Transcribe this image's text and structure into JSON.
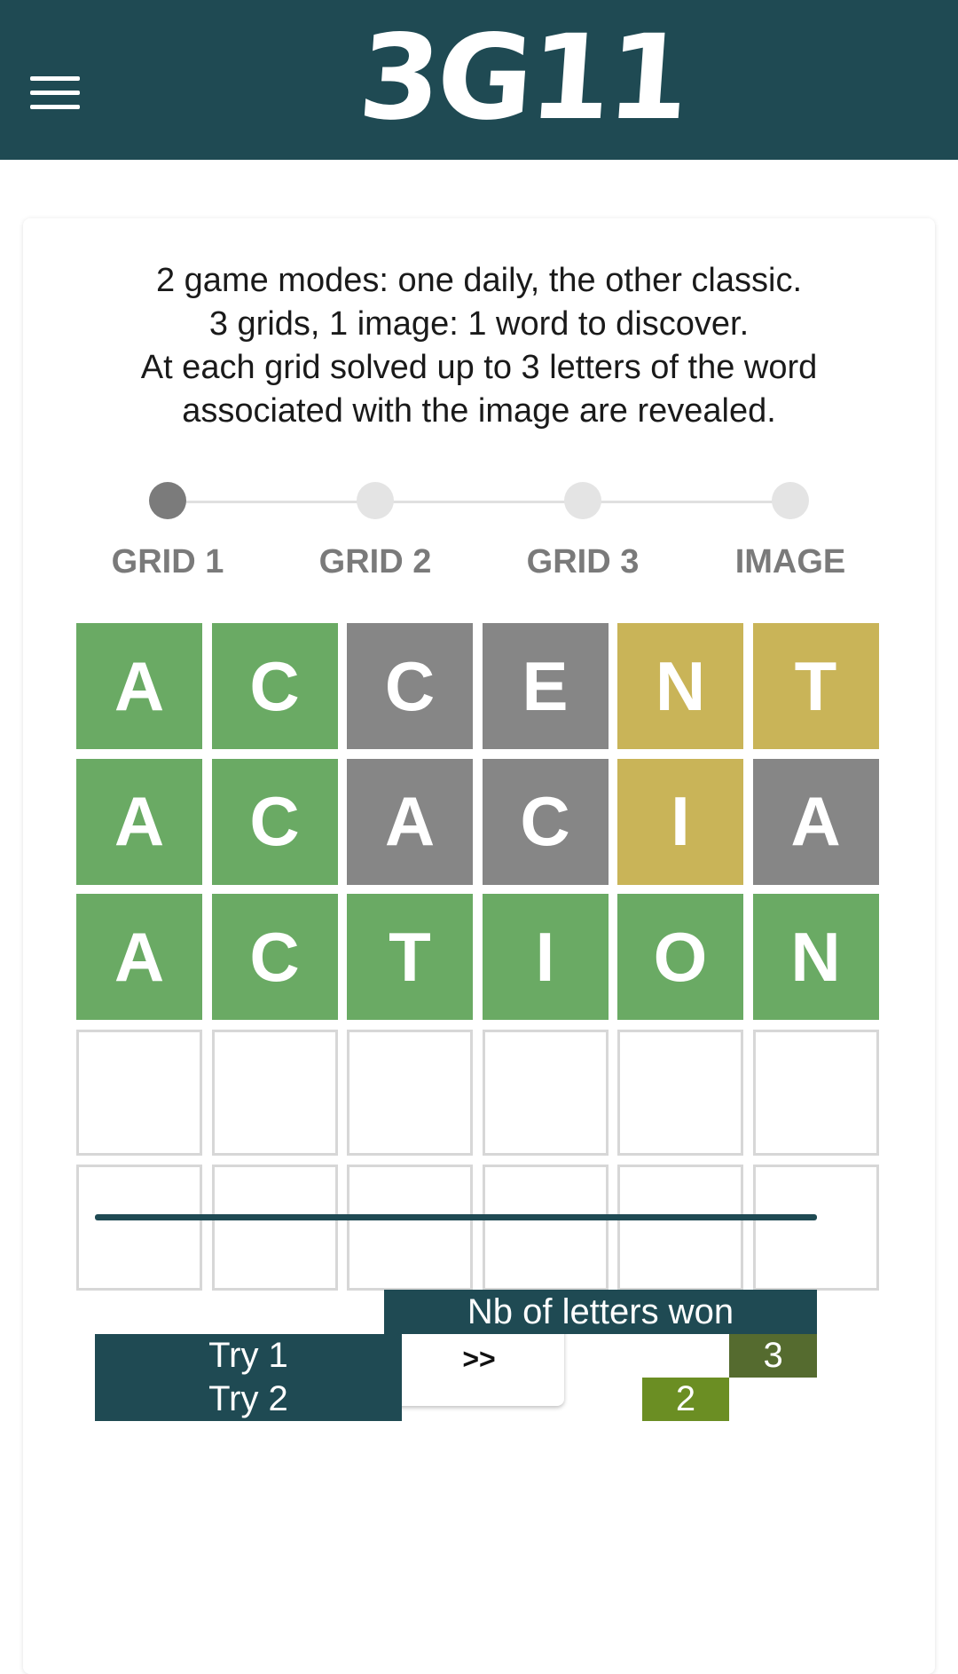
{
  "header": {
    "logo": "3G11",
    "menu_icon": "hamburger-menu-icon",
    "background": "#1f4a53"
  },
  "intro": {
    "lines": [
      "2 game modes: one daily, the other classic.",
      "3 grids, 1 image: 1 word to discover.",
      "At each grid solved up to 3 letters of the word",
      "associated with the image are revealed."
    ]
  },
  "stepper": {
    "active_index": 0,
    "steps": [
      {
        "label": "GRID 1"
      },
      {
        "label": "GRID 2"
      },
      {
        "label": "GRID 3"
      },
      {
        "label": "IMAGE"
      }
    ]
  },
  "grid": {
    "colors": {
      "green": "#6aaa64",
      "gray": "#868686",
      "yellow": "#c9b458"
    },
    "rows": [
      [
        {
          "letter": "A",
          "state": "green"
        },
        {
          "letter": "C",
          "state": "green"
        },
        {
          "letter": "C",
          "state": "gray"
        },
        {
          "letter": "E",
          "state": "gray"
        },
        {
          "letter": "N",
          "state": "yellow"
        },
        {
          "letter": "T",
          "state": "yellow"
        }
      ],
      [
        {
          "letter": "A",
          "state": "green"
        },
        {
          "letter": "C",
          "state": "green"
        },
        {
          "letter": "A",
          "state": "gray"
        },
        {
          "letter": "C",
          "state": "gray"
        },
        {
          "letter": "I",
          "state": "yellow"
        },
        {
          "letter": "A",
          "state": "gray"
        }
      ],
      [
        {
          "letter": "A",
          "state": "green"
        },
        {
          "letter": "C",
          "state": "green"
        },
        {
          "letter": "T",
          "state": "green"
        },
        {
          "letter": "I",
          "state": "green"
        },
        {
          "letter": "O",
          "state": "green"
        },
        {
          "letter": "N",
          "state": "green"
        }
      ],
      [
        {
          "letter": "",
          "state": "empty"
        },
        {
          "letter": "",
          "state": "empty"
        },
        {
          "letter": "",
          "state": "empty"
        },
        {
          "letter": "",
          "state": "empty"
        },
        {
          "letter": "",
          "state": "empty"
        },
        {
          "letter": "",
          "state": "empty"
        }
      ],
      [
        {
          "letter": "",
          "state": "empty"
        },
        {
          "letter": "",
          "state": "empty"
        },
        {
          "letter": "",
          "state": "empty"
        },
        {
          "letter": "",
          "state": "empty"
        },
        {
          "letter": "",
          "state": "empty"
        },
        {
          "letter": "",
          "state": "empty"
        }
      ]
    ]
  },
  "next_button": {
    "label": ">>"
  },
  "stats": {
    "header": "Nb of letters won",
    "max_letters": 3,
    "tries": [
      {
        "label": "Try 1",
        "value": "3",
        "color": "#556b2f"
      },
      {
        "label": "Try 2",
        "value": "2",
        "color": "#6b8e23"
      }
    ]
  }
}
